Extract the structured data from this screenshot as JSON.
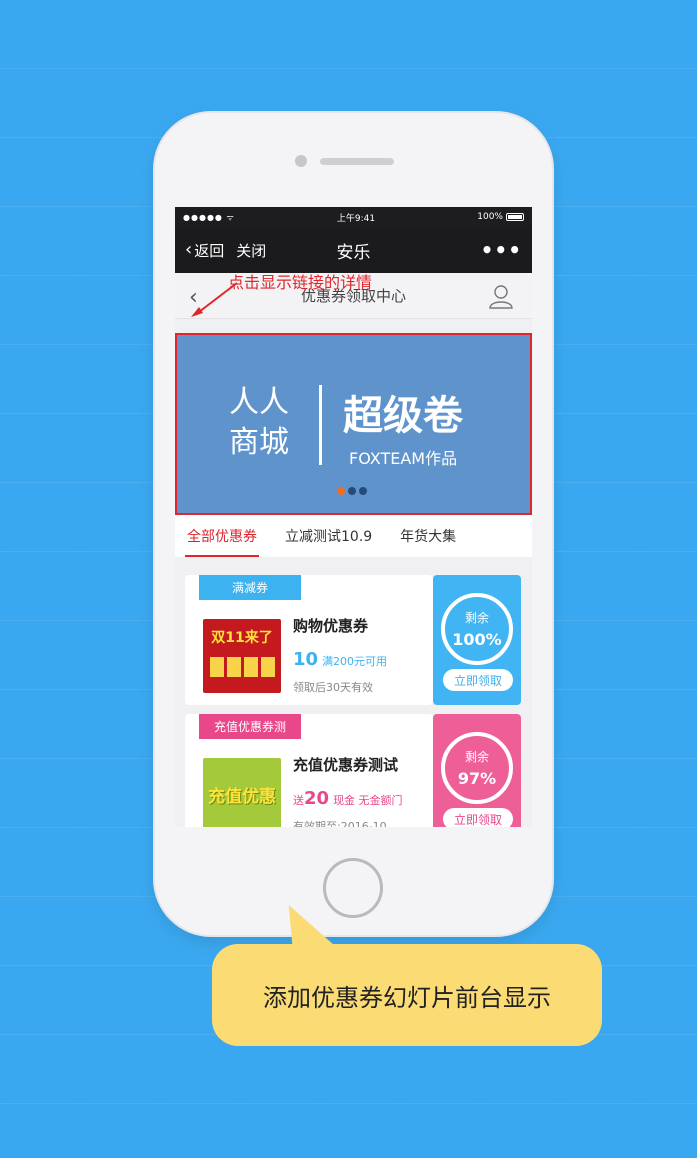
{
  "status_bar": {
    "signal": "●●●●● ᯤ",
    "time": "上午9:41",
    "battery": "100%"
  },
  "nav": {
    "back_label": "返回",
    "close_label": "关闭",
    "title": "安乐",
    "more_label": "•••"
  },
  "page_header": {
    "title": "优惠券领取中心",
    "annotation": "点击显示链接的详情"
  },
  "banner": {
    "left_line1": "人人",
    "left_line2": "商城",
    "title": "超级卷",
    "subtitle": "FOXTEAM作品",
    "dots_count": 3,
    "active_dot_index": 0
  },
  "tabs": [
    {
      "label": "全部优惠券",
      "active": true
    },
    {
      "label": "立减测试10.9",
      "active": false
    },
    {
      "label": "年货大集",
      "active": false
    }
  ],
  "coupons": [
    {
      "tag": "满减券",
      "name": "购物优惠券",
      "value_big": "10",
      "value_rest": "满200元可用",
      "note": "领取后30天有效",
      "ring_label": "剩余",
      "ring_percent": "100%",
      "claim_label": "立即领取",
      "thumb_text": "双11来了",
      "accent": "#3cb2f0",
      "side_color": "#41b4f3",
      "thumb_color": "#c41a1f"
    },
    {
      "tag": "充值优惠券测",
      "name": "充值优惠券测试",
      "value_prefix": "送",
      "value_big": "20",
      "value_rest": "现金  无金额门",
      "note": "有效期至:2016-10",
      "ring_label": "剩余",
      "ring_percent": "97%",
      "claim_label": "立即领取",
      "thumb_text": "充值优惠",
      "accent": "#e8488a",
      "side_color": "#ee5f97",
      "thumb_color": "#a4c93a"
    }
  ],
  "callout": {
    "text": "添加优惠券幻灯片前台显示"
  }
}
